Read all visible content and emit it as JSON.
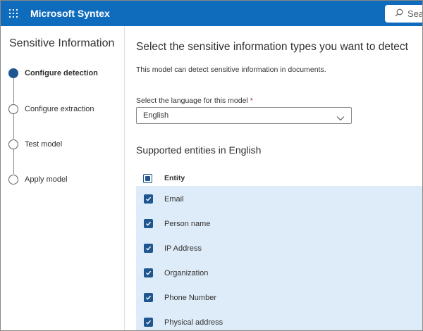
{
  "app": {
    "title": "Microsoft Syntex"
  },
  "search": {
    "placeholder": "Search"
  },
  "left_panel": {
    "title": "Sensitive Information",
    "steps": [
      {
        "label": "Configure detection",
        "active": true
      },
      {
        "label": "Configure extraction",
        "active": false
      },
      {
        "label": "Test model",
        "active": false
      },
      {
        "label": "Apply model",
        "active": false
      }
    ]
  },
  "main": {
    "title": "Select the sensitive information types you want to detect",
    "description": "This model can detect sensitive information in documents.",
    "language": {
      "label": "Select the language for this model",
      "required_marker": "*",
      "selected": "English"
    },
    "entities_title": "Supported entities in English",
    "entity_column_header": "Entity",
    "entities": [
      {
        "name": "Email",
        "checked": true
      },
      {
        "name": "Person name",
        "checked": true
      },
      {
        "name": "IP Address",
        "checked": true
      },
      {
        "name": "Organization",
        "checked": true
      },
      {
        "name": "Phone Number",
        "checked": true
      },
      {
        "name": "Physical address",
        "checked": true
      }
    ]
  },
  "colors": {
    "topbar": "#0f6cbd",
    "accent": "#1f5690",
    "selected_row_bg": "#deecf9",
    "required": "#a4262c"
  }
}
